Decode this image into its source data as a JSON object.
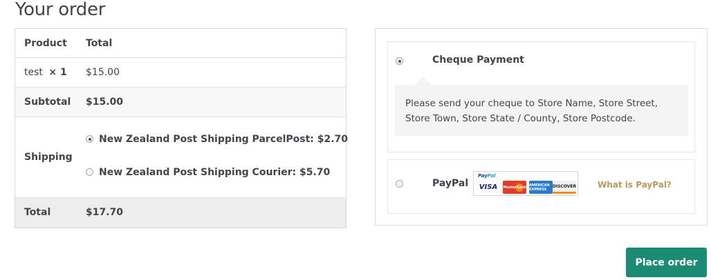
{
  "page": {
    "title": "Your order"
  },
  "order_table": {
    "headers": {
      "product": "Product",
      "total": "Total"
    },
    "items": [
      {
        "name": "test",
        "qty": "× 1",
        "total": "$15.00"
      }
    ],
    "subtotal": {
      "label": "Subtotal",
      "value": "$15.00"
    },
    "shipping": {
      "label": "Shipping",
      "options": [
        {
          "label": "New Zealand Post Shipping ParcelPost: $2.70",
          "selected": true
        },
        {
          "label": "New Zealand Post Shipping Courier: $5.70",
          "selected": false
        }
      ]
    },
    "total": {
      "label": "Total",
      "value": "$17.70"
    }
  },
  "payment": {
    "methods": [
      {
        "label": "Cheque Payment",
        "selected": true,
        "description": "Please send your cheque to Store Name, Store Street, Store Town, Store State / County, Store Postcode."
      },
      {
        "label": "PayPal",
        "selected": false,
        "logo_brand_a": "Pay",
        "logo_brand_b": "Pal",
        "cards": [
          "VISA",
          "MasterCard",
          "AMERICAN EXPRESS",
          "DISCOVER"
        ],
        "what_is_link": "What is PayPal?"
      }
    ]
  },
  "actions": {
    "place_order": "Place order"
  },
  "colors": {
    "button": "#1b8b74",
    "link": "#b79a57"
  }
}
